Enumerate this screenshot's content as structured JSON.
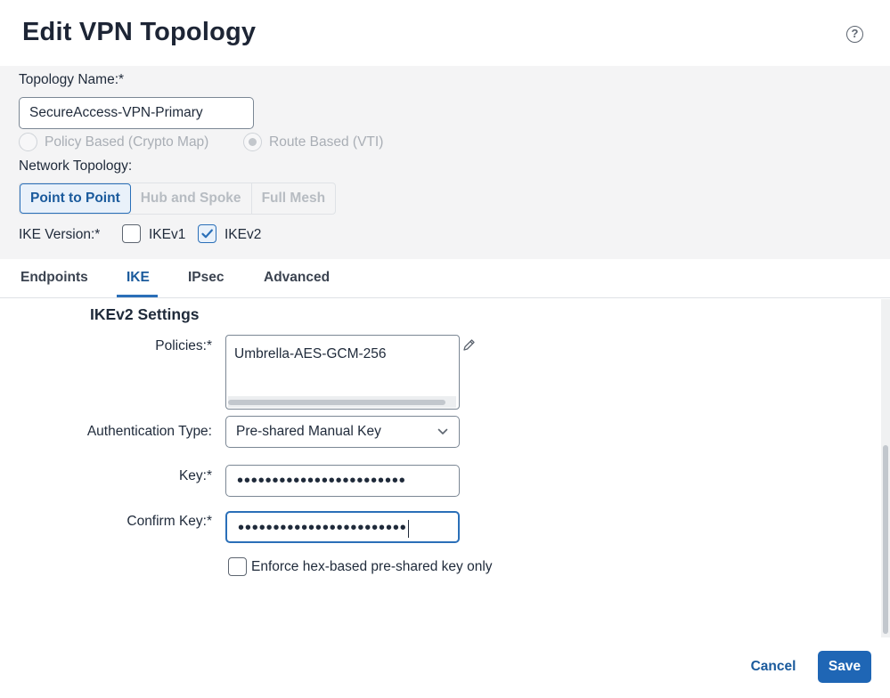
{
  "dialog": {
    "title": "Edit VPN Topology"
  },
  "topology": {
    "name_label": "Topology Name:*",
    "name_value": "SecureAccess-VPN-Primary",
    "type_options": [
      {
        "label": "Policy Based (Crypto Map)",
        "selected": false,
        "disabled": true
      },
      {
        "label": "Route Based (VTI)",
        "selected": true,
        "disabled": true
      }
    ],
    "network_label": "Network Topology:",
    "network_options": [
      "Point to Point",
      "Hub and Spoke",
      "Full Mesh"
    ],
    "network_selected": "Point to Point",
    "ike_version_label": "IKE Version:*",
    "ike_versions": [
      {
        "label": "IKEv1",
        "checked": false
      },
      {
        "label": "IKEv2",
        "checked": true
      }
    ]
  },
  "tabs": [
    {
      "label": "Endpoints",
      "active": false
    },
    {
      "label": "IKE",
      "active": true
    },
    {
      "label": "IPsec",
      "active": false
    },
    {
      "label": "Advanced",
      "active": false
    }
  ],
  "ikev2": {
    "section_title": "IKEv2 Settings",
    "policies_label": "Policies:*",
    "policies": [
      "Umbrella-AES-GCM-256"
    ],
    "auth_type_label": "Authentication Type:",
    "auth_type_value": "Pre-shared Manual Key",
    "key_label": "Key:*",
    "key_mask": "••••••••••••••••••••••••",
    "confirm_key_label": "Confirm Key:*",
    "confirm_key_mask": "••••••••••••••••••••••••",
    "enforce_hex_label": "Enforce hex-based pre-shared key only",
    "enforce_hex_checked": false
  },
  "footer": {
    "cancel_label": "Cancel",
    "save_label": "Save"
  },
  "colors": {
    "accent": "#1f66b5",
    "active_tab": "#1a5a9c",
    "panel_bg": "#f4f4f5"
  }
}
